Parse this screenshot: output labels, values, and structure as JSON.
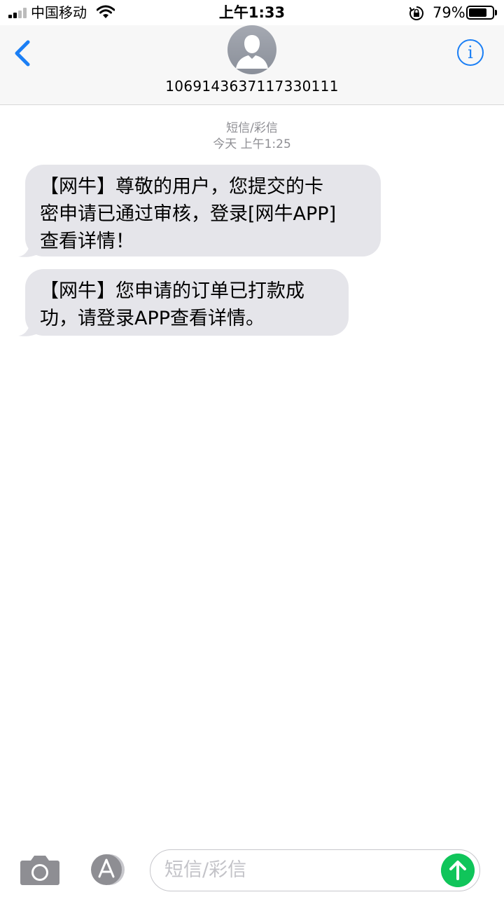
{
  "status_bar": {
    "carrier": "中国移动",
    "time": "上午1:33",
    "battery_percent_label": "79%",
    "battery_level": 0.79,
    "icons": [
      "signal-icon",
      "wifi-icon",
      "rotation-lock-icon",
      "battery-icon"
    ]
  },
  "header": {
    "contact_number": "1069143637117330111",
    "icons": [
      "back-chevron-icon",
      "avatar-silhouette-icon",
      "info-icon"
    ],
    "info_glyph": "i"
  },
  "conversation": {
    "service_label": "短信/彩信",
    "timestamp": "今天 上午1:25",
    "messages": [
      {
        "direction": "incoming",
        "lines": [
          "【网牛】尊敬的用户，您提交的卡",
          "密申请已通过审核，登录[网牛APP]",
          "查看详情！"
        ]
      },
      {
        "direction": "incoming",
        "lines": [
          "【网牛】您申请的订单已打款成",
          "功，请登录APP查看详情。"
        ]
      }
    ]
  },
  "composer": {
    "placeholder": "短信/彩信",
    "value": "",
    "icons": [
      "camera-icon",
      "app-store-icon",
      "send-arrow-icon"
    ]
  },
  "colors": {
    "accent": "#1b7ff5",
    "bubble_incoming": "#e5e5ea",
    "send_button": "#10c55a",
    "meta_text": "#8e8e93",
    "header_bg": "#f7f7f7"
  }
}
